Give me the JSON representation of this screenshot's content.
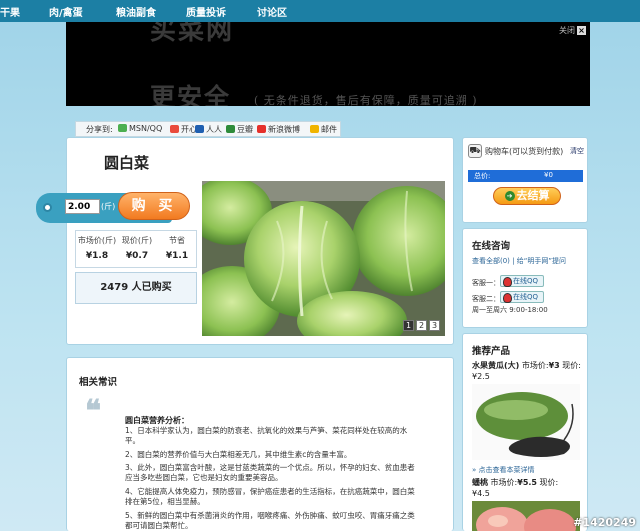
{
  "topnav": {
    "items": [
      "干果",
      "肉/禽蛋",
      "粮油副食",
      "质量投诉",
      "讨论区"
    ]
  },
  "banner": {
    "headline_top": "买菜网",
    "headline": "更安全",
    "slogan": "( 无条件退货，售后有保障，质量可追溯 )",
    "close_label": "关闭",
    "close_glyph": "×"
  },
  "share": {
    "label": "分享到:",
    "targets": [
      "MSN/QQ",
      "开心",
      "人人",
      "豆瓣",
      "新浪微博",
      "邮件"
    ]
  },
  "product": {
    "title": "圆白菜",
    "quantity": "2.00",
    "unit": "(斤)",
    "buy_label": "购 买",
    "market_price_label": "市场价(斤)",
    "current_price_label": "现价(斤)",
    "saving_label": "节省",
    "market_price": "¥1.8",
    "current_price": "¥0.7",
    "saving": "¥1.1",
    "bought_count": "2479 人已购买",
    "pages": [
      "1",
      "2",
      "3"
    ],
    "active_page": 1
  },
  "cart": {
    "icon_glyph": "⛟",
    "title": "购物车(可以货到付款)",
    "clear_label": "清空",
    "total_label": "总价:",
    "total_value": "¥0",
    "checkout_label": "去结算",
    "checkout_glyph": "➔"
  },
  "consult": {
    "title": "在线咨询",
    "link_text": "查看全部(0) | 给“明手网”提问",
    "agents": [
      {
        "label": "客服一：",
        "qq_label": "在线QQ"
      },
      {
        "label": "客服二：",
        "qq_label": "在线QQ"
      }
    ],
    "hours": "周一至周六 9:00-18:00"
  },
  "recommend": {
    "title": "推荐产品",
    "products": [
      {
        "name": "水果黄瓜(大)",
        "market_price_label": "市场价:",
        "market_price": "¥3",
        "current_price_label": "现价:",
        "current_price": "¥2.5"
      },
      {
        "name": "蟠桃",
        "market_price_label": "市场价:",
        "market_price": "¥5.5",
        "current_price_label": "现价:",
        "current_price": "¥4.5"
      }
    ],
    "detail_link": "» 点击查看本菜详情"
  },
  "knowledge": {
    "title": "相关常识",
    "quote_glyph": "❝",
    "nutrition_title": "圆白菜营养分析：",
    "paragraphs": [
      "1、日本科学家认为，圆白菜的防衰老、抗氧化的效果与芦笋、菜花同样处在较高的水平。",
      "2、圆白菜的营养价值与大白菜相差无几，其中维生素c的含量丰富。",
      "3、此外，圆白菜富含叶酸，这是甘蓝类蔬菜的一个优点。所以，怀孕的妇女、贫血患者应当多吃些圆白菜，它也是妇女的重要美容品。",
      "4、它能提高人体免疫力，预防感冒，保护癌症患者的生活指标，在抗癌蔬菜中，圆白菜排在第5位，相当显赫。",
      "5、新鲜的圆白菜中有杀菌消炎的作用，咽喉疼痛、外伤肿痛、蚊叮虫咬、胃痛牙痛之类都可请圆白菜帮忙。"
    ]
  },
  "watermark": "#1420249",
  "colors": {
    "nav": "#1c7fa4",
    "buy_button": "#f27a20",
    "checkout_button": "#f59a14",
    "total_bar": "#1f6dd8",
    "link": "#2a6496"
  }
}
